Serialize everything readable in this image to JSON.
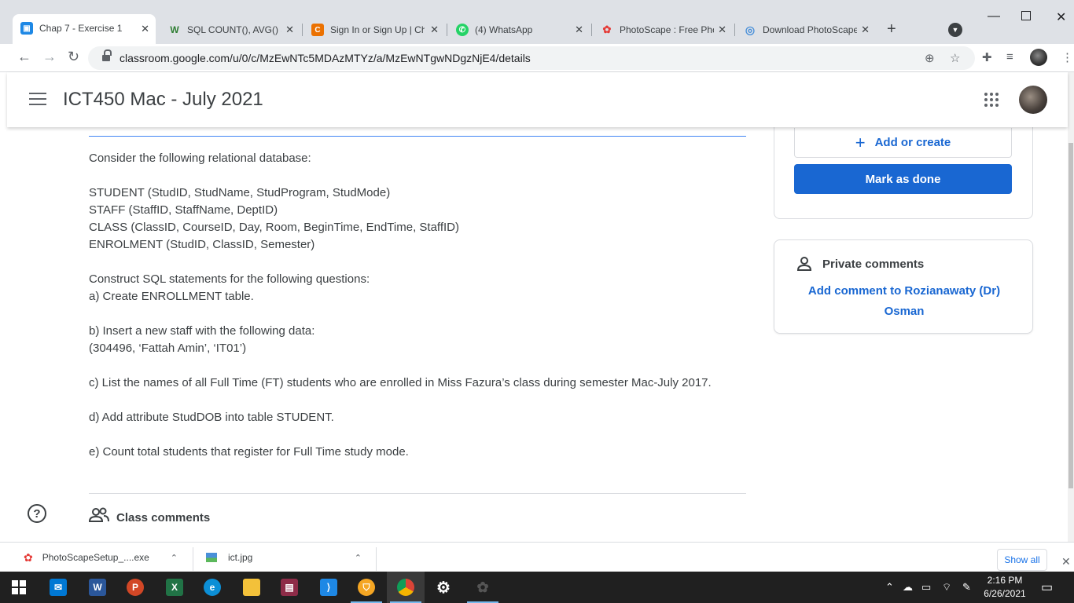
{
  "browser": {
    "tabs": [
      {
        "title": "Chap 7 - Exercise 1",
        "favicon": "classroom-icon",
        "color": "#1e88e5",
        "active": true
      },
      {
        "title": "SQL COUNT(), AVG() a",
        "favicon": "w3resource-icon",
        "color": "#2e7d32",
        "active": false
      },
      {
        "title": "Sign In or Sign Up | Ch",
        "favicon": "chegg-icon",
        "color": "#eb7100",
        "active": false
      },
      {
        "title": "(4) WhatsApp",
        "favicon": "whatsapp-icon",
        "color": "#25d366",
        "active": false
      },
      {
        "title": "PhotoScape : Free Pho",
        "favicon": "photoscape-icon",
        "color": "#e53935",
        "active": false
      },
      {
        "title": "Download PhotoScape",
        "favicon": "globe-icon",
        "color": "#4a90d9",
        "active": false
      }
    ],
    "url": "classroom.google.com/u/0/c/MzEwNTc5MDAzMTYz/a/MzEwNTgwNDgzNjE4/details"
  },
  "classroom": {
    "title": "ICT450 Mac - July 2021",
    "description": [
      "Consider the following relational database:",
      "",
      "STUDENT (StudID, StudName, StudProgram, StudMode)",
      "STAFF (StaffID, StaffName, DeptID)",
      "CLASS (ClassID, CourseID, Day, Room, BeginTime, EndTime, StaffID)",
      "ENROLMENT (StudID, ClassID, Semester)",
      "",
      "Construct SQL statements for the following questions:",
      "a) Create ENROLLMENT table.",
      "",
      "b) Insert a new staff with the following data:",
      "(304496, ‘Fattah Amin’, ‘IT01’)",
      "",
      "c) List the names of all Full Time (FT) students who are enrolled in Miss Fazura’s class during semester Mac-July 2017.",
      "",
      "d) Add attribute StudDOB into table STUDENT.",
      "",
      "e) Count total students that register for Full Time study mode."
    ],
    "class_comments_label": "Class comments",
    "add_or_create_label": "Add or create",
    "mark_as_done_label": "Mark as done",
    "private_comments_label": "Private comments",
    "add_comment_label": "Add comment to Rozianawaty (Dr) Osman"
  },
  "downloads": {
    "items": [
      {
        "name": "PhotoScapeSetup_....exe"
      },
      {
        "name": "ict.jpg"
      }
    ],
    "show_all_label": "Show all"
  },
  "taskbar": {
    "time": "2:16 PM",
    "date": "6/26/2021"
  },
  "colors": {
    "accent": "#1967d2",
    "title_text": "#3c4043"
  }
}
